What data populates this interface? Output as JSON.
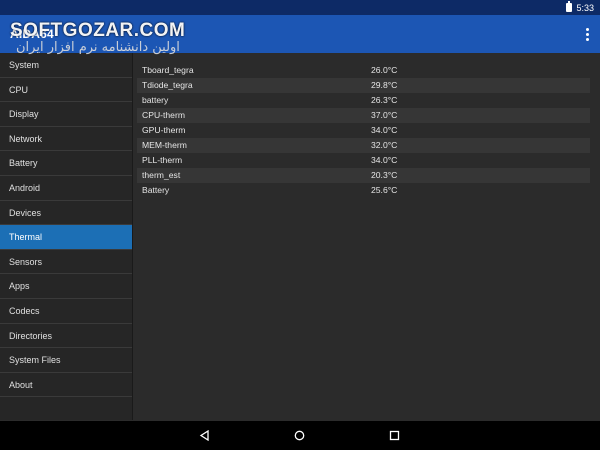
{
  "status_bar": {
    "time": "5:33",
    "battery_icon": "battery-icon"
  },
  "app_bar": {
    "title": "AIDA64",
    "menu_icon": "overflow-menu-icon"
  },
  "watermark": {
    "line1": "SOFTGOZAR.COM",
    "line2": "اولین دانشنامه نرم افزار ایران"
  },
  "sidebar": {
    "items": [
      {
        "label": "System",
        "active": false
      },
      {
        "label": "CPU",
        "active": false
      },
      {
        "label": "Display",
        "active": false
      },
      {
        "label": "Network",
        "active": false
      },
      {
        "label": "Battery",
        "active": false
      },
      {
        "label": "Android",
        "active": false
      },
      {
        "label": "Devices",
        "active": false
      },
      {
        "label": "Thermal",
        "active": true
      },
      {
        "label": "Sensors",
        "active": false
      },
      {
        "label": "Apps",
        "active": false
      },
      {
        "label": "Codecs",
        "active": false
      },
      {
        "label": "Directories",
        "active": false
      },
      {
        "label": "System Files",
        "active": false
      },
      {
        "label": "About",
        "active": false
      }
    ],
    "active_color": "#1c6fb5"
  },
  "thermal": {
    "rows": [
      {
        "name": "Tboard_tegra",
        "value": "26.0°C"
      },
      {
        "name": "Tdiode_tegra",
        "value": "29.8°C"
      },
      {
        "name": "battery",
        "value": "26.3°C"
      },
      {
        "name": "CPU-therm",
        "value": "37.0°C"
      },
      {
        "name": "GPU-therm",
        "value": "34.0°C"
      },
      {
        "name": "MEM-therm",
        "value": "32.0°C"
      },
      {
        "name": "PLL-therm",
        "value": "34.0°C"
      },
      {
        "name": "therm_est",
        "value": "20.3°C"
      },
      {
        "name": "Battery",
        "value": "25.6°C"
      }
    ]
  },
  "nav_bar": {
    "back_icon": "back-icon",
    "home_icon": "home-icon",
    "recents_icon": "recents-icon"
  },
  "colors": {
    "app_bar": "#1c56b4",
    "status_bar": "#0d2a66",
    "background": "#2b2b2b"
  }
}
